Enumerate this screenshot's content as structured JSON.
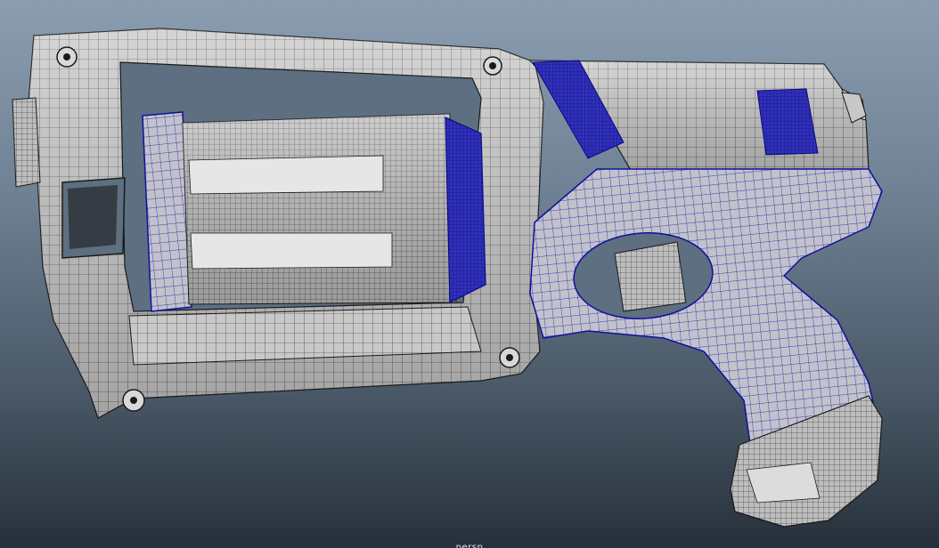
{
  "viewport": {
    "camera_label": "persp",
    "background_top": "#8b9db0",
    "background_bottom": "#26303a"
  },
  "model": {
    "description_icon": "toy-revolver-wireframe",
    "colors": {
      "surface": "#c9c9c9",
      "surface_dark": "#9a9a9a",
      "surface_light": "#e0e0e0",
      "wire": "#1b1b1b",
      "selected_wire": "#10109a",
      "selected_surface": "#b8b8c8"
    }
  }
}
